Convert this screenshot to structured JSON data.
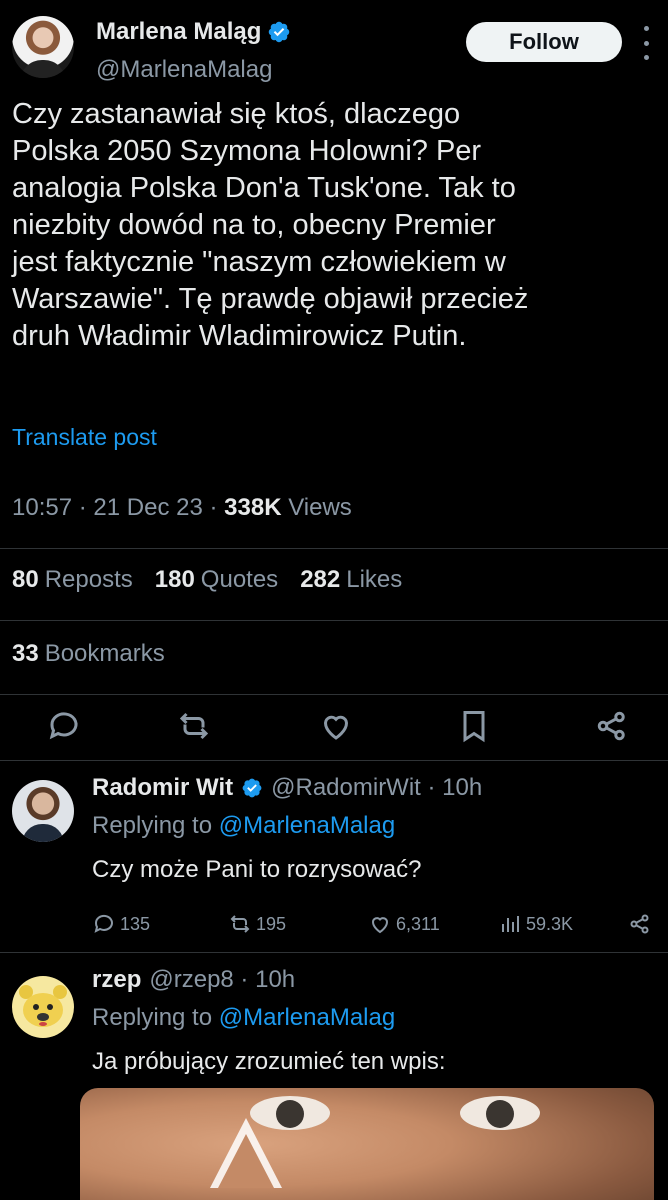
{
  "post": {
    "author": {
      "name": "Marlena Maląg",
      "handle": "@MarlenaMalag",
      "verified": true
    },
    "follow_label": "Follow",
    "text": "Czy zastanawiał się ktoś, dlaczego\nPolska 2050 Szymona Holowni? Per\nanalogia Polska Don'a Tusk'one. Tak to\nniezbity dowód na to, obecny Premier\njest faktycznie \"naszym człowiekiem w\nWarszawie\". Tę prawdę objawił przecież\ndruh Władimir Wladimirowicz Putin.",
    "translate_label": "Translate post",
    "time": "10:57",
    "date": "21 Dec 23",
    "views_count": "338K",
    "views_label": "Views",
    "stats": {
      "reposts_count": "80",
      "reposts_label": "Reposts",
      "quotes_count": "180",
      "quotes_label": "Quotes",
      "likes_count": "282",
      "likes_label": "Likes",
      "bookmarks_count": "33",
      "bookmarks_label": "Bookmarks"
    },
    "icons": [
      "reply-icon",
      "repost-icon",
      "like-icon",
      "bookmark-icon",
      "share-icon"
    ]
  },
  "replies": [
    {
      "name": "Radomir Wit",
      "verified": true,
      "handle": "@RadomirWit",
      "time": "10h",
      "replying_prefix": "Replying to",
      "replying_to": "@MarlenaMalag",
      "text": "Czy może Pani to rozrysować?",
      "replies": "135",
      "reposts": "195",
      "likes": "6,311",
      "views": "59.3K"
    },
    {
      "name": "rzep",
      "verified": false,
      "handle": "@rzep8",
      "time": "10h",
      "replying_prefix": "Replying to",
      "replying_to": "@MarlenaMalag",
      "text": "Ja próbujący zrozumieć ten wpis:"
    }
  ],
  "colors": {
    "background": "#000000",
    "text": "#e7e9ea",
    "secondary": "#8b98a5",
    "accent": "#1d9bf0",
    "divider": "#2f3336"
  }
}
